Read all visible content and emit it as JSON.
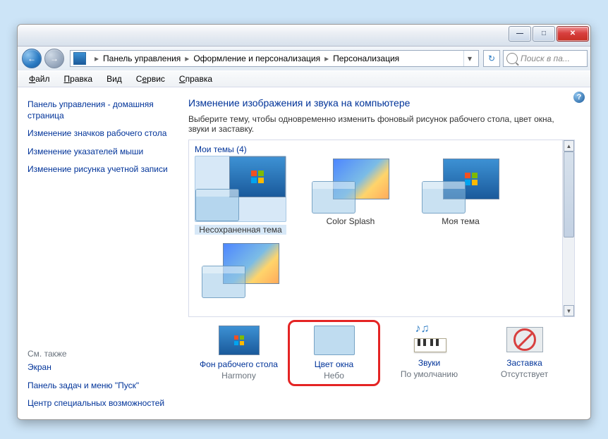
{
  "breadcrumb": {
    "a": "Панель управления",
    "b": "Оформление и персонализация",
    "c": "Персонализация"
  },
  "search": {
    "placeholder": "Поиск в па..."
  },
  "menu": {
    "file": "Файл",
    "edit": "Правка",
    "view": "Вид",
    "tools": "Сервис",
    "help": "Справка"
  },
  "sidebar": {
    "items": [
      "Панель управления - домашняя страница",
      "Изменение значков рабочего стола",
      "Изменение указателей мыши",
      "Изменение рисунка учетной записи"
    ],
    "see": "См. также",
    "extra": [
      "Экран",
      "Панель задач и меню \"Пуск\"",
      "Центр специальных возможностей"
    ]
  },
  "main": {
    "title": "Изменение изображения и звука на компьютере",
    "desc": "Выберите тему, чтобы одновременно изменить фоновый рисунок рабочего стола, цвет окна, звуки и заставку.",
    "group": "Мои темы (4)",
    "themes": [
      "Несохраненная тема",
      "Color Splash",
      "Моя тема",
      ""
    ],
    "opts": {
      "bg": {
        "t": "Фон рабочего стола",
        "s": "Harmony"
      },
      "col": {
        "t": "Цвет окна",
        "s": "Небо"
      },
      "snd": {
        "t": "Звуки",
        "s": "По умолчанию"
      },
      "sav": {
        "t": "Заставка",
        "s": "Отсутствует"
      }
    }
  }
}
